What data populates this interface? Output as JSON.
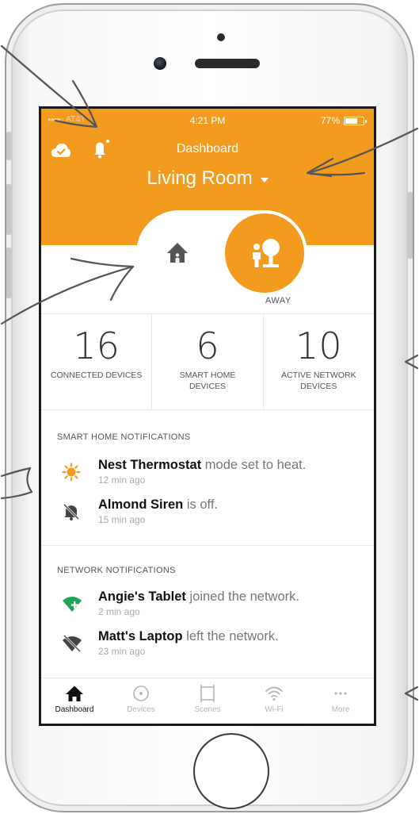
{
  "status_bar": {
    "carrier": "AT&T",
    "time": "4:21 PM",
    "battery_text": "77%",
    "battery_level": 0.77
  },
  "header": {
    "title": "Dashboard",
    "location": "Living Room"
  },
  "mode": {
    "current_label": "AWAY"
  },
  "stats": [
    {
      "value": "16",
      "label": "CONNECTED DEVICES"
    },
    {
      "value": "6",
      "label": "SMART HOME DEVICES"
    },
    {
      "value": "10",
      "label": "ACTIVE NETWORK DEVICES"
    }
  ],
  "smart_home": {
    "title": "SMART HOME NOTIFICATIONS",
    "items": [
      {
        "device": "Nest Thermostat",
        "message": "mode set to heat.",
        "time": "12 min ago",
        "icon": "sun-icon"
      },
      {
        "device": "Almond Siren",
        "message": "is off.",
        "time": "15 min ago",
        "icon": "bell-off-icon"
      }
    ]
  },
  "network": {
    "title": "NETWORK NOTIFICATIONS",
    "items": [
      {
        "device": "Angie's Tablet",
        "message": "joined the network.",
        "time": "2 min ago",
        "icon": "wifi-plus-icon"
      },
      {
        "device": "Matt's Laptop",
        "message": "left the network.",
        "time": "23 min ago",
        "icon": "wifi-off-icon"
      }
    ]
  },
  "tabs": [
    {
      "label": "Dashboard",
      "icon": "home-icon",
      "active": true
    },
    {
      "label": "Devices",
      "icon": "devices-icon",
      "active": false
    },
    {
      "label": "Scenes",
      "icon": "scenes-icon",
      "active": false
    },
    {
      "label": "Wi-Fi",
      "icon": "wifi-icon",
      "active": false
    },
    {
      "label": "More",
      "icon": "more-icon",
      "active": false
    }
  ],
  "colors": {
    "accent": "#f39b1f",
    "wifi_green": "#1ea35a",
    "text_dark": "#111111",
    "text_muted": "#777777"
  }
}
